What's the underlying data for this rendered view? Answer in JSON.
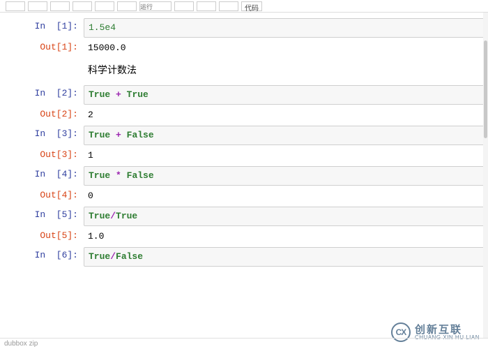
{
  "toolbar": {
    "dropdown_label": "代码",
    "buttons": [
      "",
      "",
      "",
      "",
      "",
      "",
      "运行",
      "",
      "",
      ""
    ]
  },
  "cells": {
    "c1": {
      "in_label": "In",
      "in_num": "[1]:",
      "code_tokens": [
        "1.5e4"
      ],
      "out_label": "Out",
      "out_num": "[1]:",
      "output": "15000.0"
    },
    "md1": {
      "text": "科学计数法"
    },
    "c2": {
      "in_label": "In",
      "in_num": "[2]:",
      "out_label": "Out",
      "out_num": "[2]:",
      "output": "2"
    },
    "c3": {
      "in_label": "In",
      "in_num": "[3]:",
      "out_label": "Out",
      "out_num": "[3]:",
      "output": "1"
    },
    "c4": {
      "in_label": "In",
      "in_num": "[4]:",
      "out_label": "Out",
      "out_num": "[4]:",
      "output": "0"
    },
    "c5": {
      "in_label": "In",
      "in_num": "[5]:",
      "out_label": "Out",
      "out_num": "[5]:",
      "output": "1.0"
    },
    "c6": {
      "in_label": "In",
      "in_num": "[6]:"
    }
  },
  "tokens": {
    "True": "True",
    "False": "False",
    "plus": "+",
    "times": "*",
    "slash": "/"
  },
  "watermark": {
    "logo": "CX",
    "cn": "创新互联",
    "py": "CHUANG XIN HU LIAN"
  },
  "footer": {
    "text": "dubbox    zip"
  }
}
